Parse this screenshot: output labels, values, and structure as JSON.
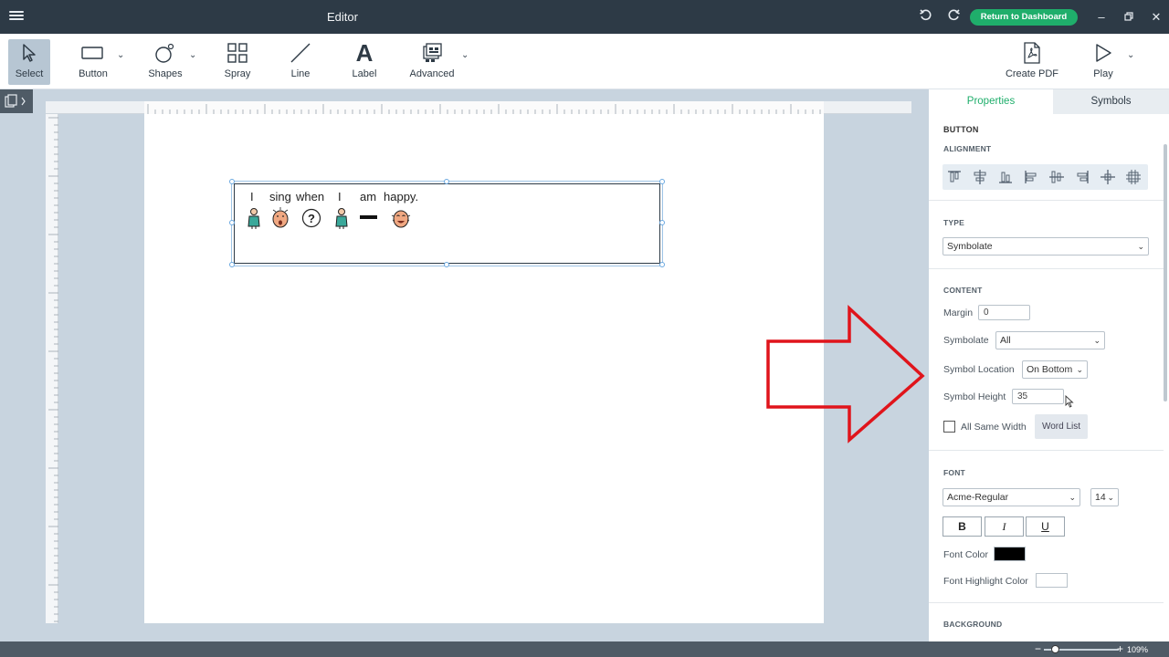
{
  "titlebar": {
    "title": "Editor",
    "return_label": "Return to Dashboard",
    "undo_icon": "undo-icon",
    "redo_icon": "redo-icon",
    "accent": "#1fae6b"
  },
  "toolbar": {
    "tools": {
      "select": "Select",
      "button": "Button",
      "shapes": "Shapes",
      "spray": "Spray",
      "line": "Line",
      "label": "Label",
      "advanced": "Advanced",
      "create_pdf": "Create PDF",
      "play": "Play"
    },
    "label_glyph": "A"
  },
  "canvas": {
    "sentence_words": [
      "I",
      "sing",
      "when",
      "I",
      "am",
      "happy."
    ],
    "symbols": [
      "person-symbol",
      "singing-face-symbol",
      "question-symbol",
      "person-symbol",
      "dash-symbol",
      "happy-face-symbol"
    ]
  },
  "panel": {
    "tabs": [
      "Properties",
      "Symbols"
    ],
    "button_title": "BUTTON",
    "alignment_title": "ALIGNMENT",
    "type_title": "TYPE",
    "type_value": "Symbolate",
    "content_title": "CONTENT",
    "margin_label": "Margin",
    "margin_value": "0",
    "symbolate_label": "Symbolate",
    "symbolate_value": "All",
    "symbol_location_label": "Symbol Location",
    "symbol_location_value": "On Bottom",
    "symbol_height_label": "Symbol Height",
    "symbol_height_value": "35",
    "all_same_width_label": "All Same Width",
    "word_list_label": "Word List",
    "font_title": "FONT",
    "font_value": "Acme-Regular",
    "font_size_value": "14",
    "bold_label": "B",
    "italic_label": "I",
    "underline_label": "U",
    "font_color_label": "Font Color",
    "font_color": "#000000",
    "font_highlight_label": "Font Highlight Color",
    "font_highlight_color": "#ffffff",
    "background_title": "BACKGROUND"
  },
  "zoom": {
    "value": "109%"
  },
  "annotation": {
    "arrow_color": "#e0141b"
  }
}
